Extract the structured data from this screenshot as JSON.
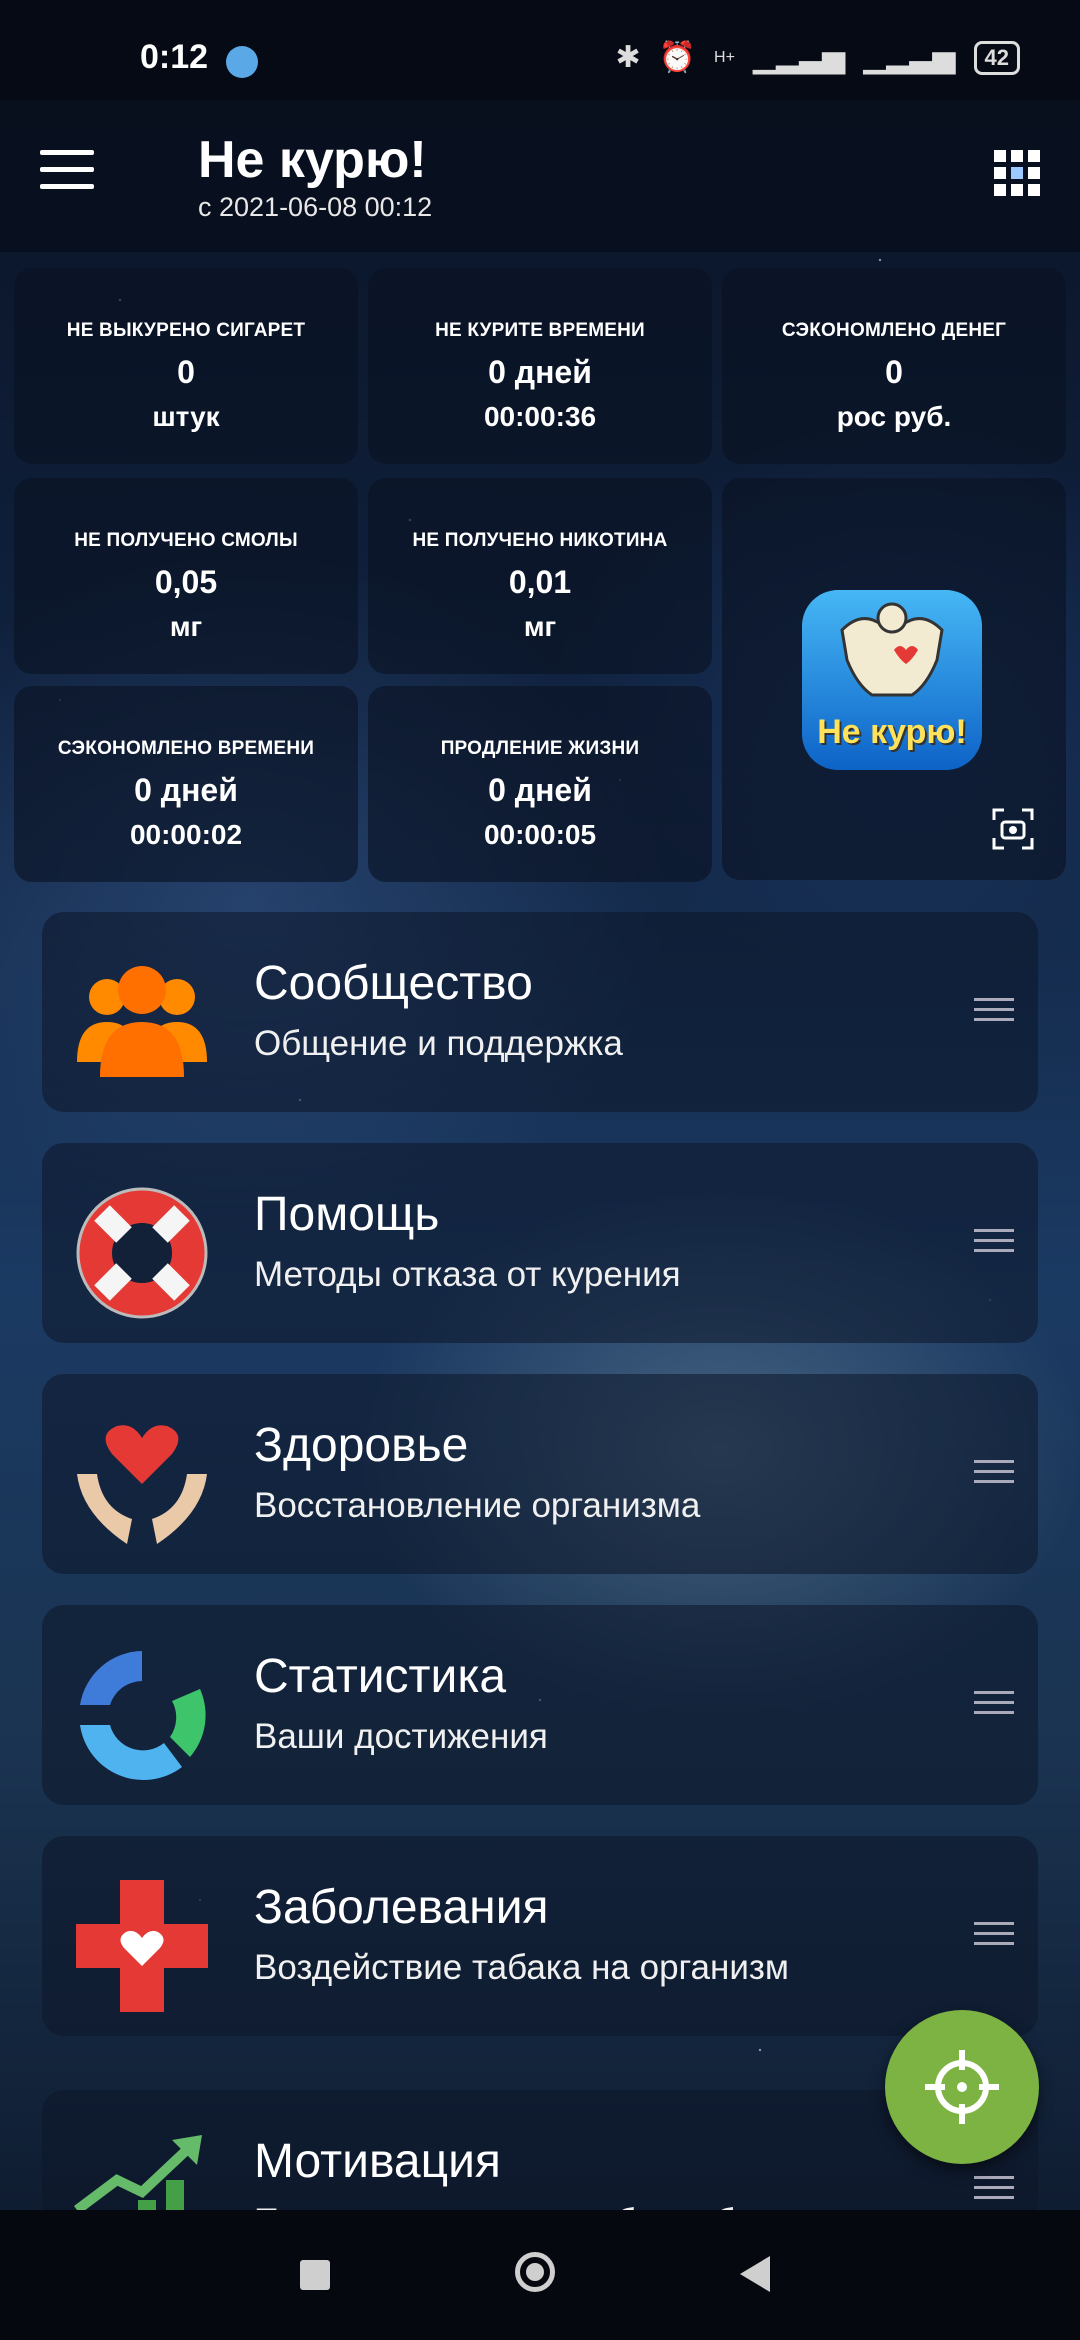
{
  "status_bar": {
    "time": "0:12",
    "signal_label": "H+",
    "battery": "42"
  },
  "app_bar": {
    "title": "Не курю!",
    "subtitle": "с 2021-06-08 00:12"
  },
  "stats": [
    {
      "label": "НЕ ВЫКУРЕНО СИГАРЕТ",
      "value": "0",
      "unit": "штук"
    },
    {
      "label": "НЕ КУРИТЕ ВРЕМЕНИ",
      "value": "0 дней",
      "unit": "00:00:36"
    },
    {
      "label": "СЭКОНОМЛЕНО ДЕНЕГ",
      "value": "0",
      "unit": "рос руб."
    },
    {
      "label": "НЕ ПОЛУЧЕНО СМОЛЫ",
      "value": "0,05",
      "unit": "мг"
    },
    {
      "label": "НЕ ПОЛУЧЕНО НИКОТИНА",
      "value": "0,01",
      "unit": "мг"
    },
    {
      "label": "СЭКОНОМЛЕНО ВРЕМЕНИ",
      "value": "0 дней",
      "unit": "00:00:02"
    },
    {
      "label": "ПРОДЛЕНИЕ ЖИЗНИ",
      "value": "0 дней",
      "unit": "00:00:05"
    }
  ],
  "logo": {
    "text": "Не курю!"
  },
  "cards": [
    {
      "title": "Сообщество",
      "subtitle": "Общение и поддержка",
      "icon": "community-icon"
    },
    {
      "title": "Помощь",
      "subtitle": "Методы отказа от курения",
      "icon": "lifebuoy-icon"
    },
    {
      "title": "Здоровье",
      "subtitle": "Восстановление организма",
      "icon": "heart-hands-icon"
    },
    {
      "title": "Статистика",
      "subtitle": "Ваши достижения",
      "icon": "statistics-ring-icon"
    },
    {
      "title": "Заболевания",
      "subtitle": "Воздействие табака на организм",
      "icon": "medical-cross-icon"
    },
    {
      "title": "Мотивация",
      "subtitle": "Преимущества жизни без табака",
      "icon": "growth-chart-icon"
    }
  ],
  "colors": {
    "fab": "#7cb342",
    "community": "#ff8a00",
    "lifebuoy": "#e53935",
    "heart": "#e53935"
  }
}
